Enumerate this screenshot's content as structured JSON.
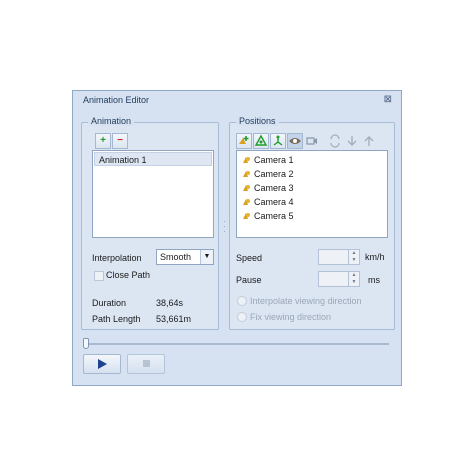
{
  "window": {
    "title": "Animation Editor",
    "close_icon": "close-icon"
  },
  "animation": {
    "group_title": "Animation",
    "add_label": "+",
    "remove_label": "−",
    "items": [
      {
        "label": "Animation 1",
        "selected": true
      }
    ],
    "interpolation_label": "Interpolation",
    "interpolation_value": "Smooth",
    "close_path_label": "Close Path",
    "duration_label": "Duration",
    "duration_value": "38,64s",
    "path_length_label": "Path Length",
    "path_length_value": "53,661m"
  },
  "positions": {
    "group_title": "Positions",
    "toolbar_icons": [
      "add-camera-icon",
      "move-up-camera-icon",
      "move-down-camera-icon",
      "eye-icon",
      "edit-camera-icon",
      "refresh-icon",
      "arrow-down-icon",
      "arrow-up-icon"
    ],
    "items": [
      {
        "label": "Camera 1"
      },
      {
        "label": "Camera 2"
      },
      {
        "label": "Camera 3"
      },
      {
        "label": "Camera 4"
      },
      {
        "label": "Camera 5"
      }
    ],
    "speed_label": "Speed",
    "speed_unit": "km/h",
    "pause_label": "Pause",
    "pause_unit": "ms",
    "interpolate_label": "Interpolate viewing direction",
    "fix_label": "Fix viewing direction"
  },
  "playback": {
    "slider_value": 0,
    "play_icon": "play-icon",
    "stop_icon": "stop-icon"
  },
  "colors": {
    "accent_green": "#1e9d2b",
    "accent_red": "#d22525",
    "window_bg": "#d6e2f1",
    "play_blue": "#20438f"
  }
}
